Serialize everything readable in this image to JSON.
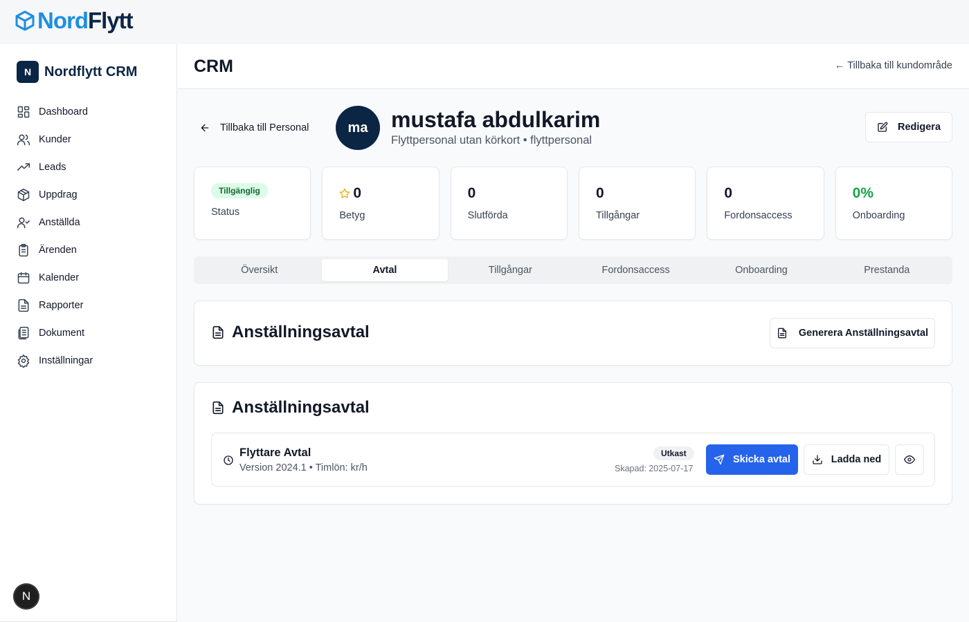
{
  "brand": {
    "part1": "Nord",
    "part2": "Flytt",
    "icon": "cube-icon"
  },
  "sidebar": {
    "logo_letter": "N",
    "logo_text": "Nordflytt CRM",
    "items": [
      {
        "label": "Dashboard",
        "icon": "dashboard-icon"
      },
      {
        "label": "Kunder",
        "icon": "users-icon"
      },
      {
        "label": "Leads",
        "icon": "trending-up-icon"
      },
      {
        "label": "Uppdrag",
        "icon": "package-icon"
      },
      {
        "label": "Anställda",
        "icon": "user-check-icon"
      },
      {
        "label": "Ärenden",
        "icon": "clipboard-icon"
      },
      {
        "label": "Kalender",
        "icon": "calendar-icon"
      },
      {
        "label": "Rapporter",
        "icon": "file-text-icon"
      },
      {
        "label": "Dokument",
        "icon": "documents-icon"
      },
      {
        "label": "Inställningar",
        "icon": "settings-icon"
      }
    ],
    "badge_letter": "N"
  },
  "header": {
    "title": "CRM",
    "back_link": "← Tillbaka till kundområde"
  },
  "profile": {
    "back_label": "Tillbaka till Personal",
    "initials": "ma",
    "name": "mustafa abdulkarim",
    "subtitle": "Flyttpersonal utan körkort • flyttpersonal",
    "edit_label": "Redigera"
  },
  "stats": {
    "status_badge": "Tillgänglig",
    "status_label": "Status",
    "rating_value": "0",
    "rating_label": "Betyg",
    "completed_value": "0",
    "completed_label": "Slutförda",
    "assets_value": "0",
    "assets_label": "Tillgångar",
    "vehicle_value": "0",
    "vehicle_label": "Fordonsaccess",
    "onboarding_value": "0%",
    "onboarding_label": "Onboarding"
  },
  "tabs": [
    "Översikt",
    "Avtal",
    "Tillgångar",
    "Fordonsaccess",
    "Onboarding",
    "Prestanda"
  ],
  "active_tab": "Avtal",
  "contracts_card": {
    "title": "Anställningsavtal",
    "generate_label": "Generera Anställningsavtal"
  },
  "list_card": {
    "title": "Anställningsavtal",
    "contract": {
      "title": "Flyttare Avtal",
      "meta": "Version 2024.1 • Timlön: kr/h",
      "badge": "Utkast",
      "created": "Skapad: 2025-07-17",
      "send_label": "Skicka avtal",
      "download_label": "Ladda ned"
    }
  },
  "colors": {
    "navy": "#0b2545",
    "brand_blue": "#1d8fe0",
    "primary": "#2563eb",
    "success": "#16a34a",
    "success_bg": "#dcfce7"
  }
}
